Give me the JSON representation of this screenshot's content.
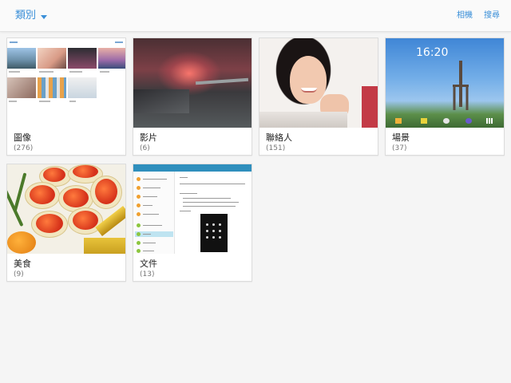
{
  "header": {
    "category_dropdown_label": "類別",
    "actions": {
      "albums": "相機",
      "search": "搜尋"
    }
  },
  "categories": [
    {
      "name": "圖像",
      "count": "(276)"
    },
    {
      "name": "影片",
      "count": "(6)"
    },
    {
      "name": "聯絡人",
      "count": "(151)"
    },
    {
      "name": "場景",
      "count": "(37)"
    },
    {
      "name": "美食",
      "count": "(9)"
    },
    {
      "name": "文件",
      "count": "(13)"
    }
  ],
  "thumbnails": {
    "scenery_clock": "16:20"
  },
  "colors": {
    "accent": "#3a8fd8",
    "background": "#f5f5f5",
    "card": "#ffffff"
  },
  "icons": {
    "dropdown": "chevron-down-icon"
  }
}
